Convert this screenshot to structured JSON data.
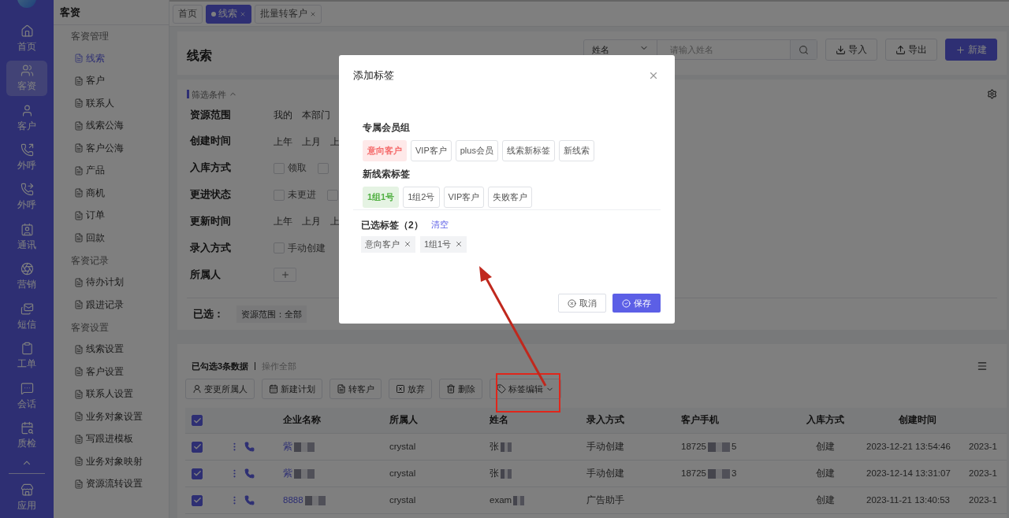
{
  "nav": [
    {
      "label": "首页",
      "selected": false
    },
    {
      "label": "客资",
      "selected": true
    },
    {
      "label": "客户",
      "selected": false
    },
    {
      "label": "外呼",
      "selected": false
    },
    {
      "label": "外呼",
      "selected": false
    },
    {
      "label": "通讯",
      "selected": false
    },
    {
      "label": "营销",
      "selected": false
    },
    {
      "label": "短信",
      "selected": false
    },
    {
      "label": "工单",
      "selected": false
    },
    {
      "label": "会话",
      "selected": false
    },
    {
      "label": "质检",
      "selected": false
    },
    {
      "label": "应用",
      "selected": false
    }
  ],
  "sidebar": {
    "title": "客资",
    "groups": [
      {
        "heading": "客资管理",
        "items": [
          {
            "label": "线索",
            "selected": true
          },
          {
            "label": "客户",
            "selected": false
          },
          {
            "label": "联系人",
            "selected": false
          },
          {
            "label": "线索公海",
            "selected": false
          },
          {
            "label": "客户公海",
            "selected": false
          },
          {
            "label": "产品",
            "selected": false
          },
          {
            "label": "商机",
            "selected": false
          },
          {
            "label": "订单",
            "selected": false
          },
          {
            "label": "回款",
            "selected": false
          }
        ]
      },
      {
        "heading": "客资记录",
        "items": [
          {
            "label": "待办计划",
            "selected": false
          },
          {
            "label": "跟进记录",
            "selected": false
          }
        ]
      },
      {
        "heading": "客资设置",
        "items": [
          {
            "label": "线索设置",
            "selected": false
          },
          {
            "label": "客户设置",
            "selected": false
          },
          {
            "label": "联系人设置",
            "selected": false
          },
          {
            "label": "业务对象设置",
            "selected": false
          },
          {
            "label": "写跟进模板",
            "selected": false
          },
          {
            "label": "业务对象映射",
            "selected": false
          },
          {
            "label": "资源流转设置",
            "selected": false
          }
        ]
      }
    ]
  },
  "tabs": [
    {
      "label": "首页",
      "selected": false,
      "closable": false
    },
    {
      "label": "线索",
      "selected": true,
      "closable": true
    },
    {
      "label": "批量转客户",
      "selected": false,
      "closable": true
    }
  ],
  "header": {
    "title": "线索",
    "search_field": "姓名",
    "search_placeholder": "请输入姓名",
    "buttons": [
      {
        "label": "导入",
        "kind": "import"
      },
      {
        "label": "导出",
        "kind": "export"
      },
      {
        "label": "新建",
        "kind": "primary"
      }
    ]
  },
  "filters": {
    "title": "筛选条件",
    "rows": [
      {
        "label": "资源范围",
        "kind": "options",
        "options": [
          "我的",
          "本部门"
        ]
      },
      {
        "label": "创建时间",
        "kind": "options",
        "options": [
          "上年",
          "上月",
          "上"
        ]
      },
      {
        "label": "入库方式",
        "kind": "checkboxes",
        "options": [
          {
            "label": "领取",
            "checked": false
          },
          {
            "checked": false
          }
        ]
      },
      {
        "label": "更进状态",
        "kind": "checkboxes",
        "options": [
          {
            "label": "未更进",
            "checked": false
          },
          {
            "checked": false
          }
        ]
      },
      {
        "label": "更新时间",
        "kind": "options",
        "options": [
          "上年",
          "上月",
          "上"
        ]
      },
      {
        "label": "录入方式",
        "kind": "checkboxes",
        "options": [
          {
            "label": "手动创建",
            "checked": false
          }
        ]
      },
      {
        "label": "所属人",
        "kind": "add"
      }
    ],
    "summary_label": "已选：",
    "summary_chips": [
      "资源范围：全部"
    ]
  },
  "table": {
    "selection_text": "已勾选3条数据",
    "select_all": "操作全部",
    "actions": [
      {
        "label": "变更所属人"
      },
      {
        "label": "新建计划"
      },
      {
        "label": "转客户"
      },
      {
        "label": "放弃"
      },
      {
        "label": "删除"
      },
      {
        "label": "标签编辑",
        "kind": "dropdown"
      }
    ],
    "header_checked": true,
    "columns": [
      "企业名称",
      "所属人",
      "姓名",
      "录入方式",
      "客户手机",
      "入库方式",
      "创建时间"
    ],
    "rows": [
      {
        "checked": true,
        "company": "紫",
        "owner": "crystal",
        "name": "张",
        "entry": "手动创建",
        "phone_start": "18725",
        "phone_end": "5",
        "storage": "创建",
        "created": "2023-12-21 13:54:46",
        "column_9": "2023-1"
      },
      {
        "checked": true,
        "company": "紫",
        "owner": "crystal",
        "name": "张",
        "entry": "手动创建",
        "phone_start": "18725",
        "phone_end": "3",
        "storage": "创建",
        "created": "2023-12-14 13:31:07",
        "column_9": "2023-1"
      },
      {
        "checked": true,
        "company": "8888",
        "owner": "crystal",
        "name": "exam",
        "entry": "广告助手",
        "storage": "创建",
        "created": "2023-11-21 13:40:53",
        "column_9": "2023-1"
      }
    ]
  },
  "modal": {
    "title": "添加标签",
    "groups": [
      {
        "heading": "专属会员组",
        "tags": [
          {
            "label": "意向客户",
            "selected": true,
            "color": "#f56c6c"
          },
          {
            "label": "VIP客户",
            "selected": false
          },
          {
            "label": "plus会员",
            "selected": false
          },
          {
            "label": "线索新标签",
            "selected": false
          },
          {
            "label": "新线索",
            "selected": false
          }
        ]
      },
      {
        "heading": "新线索标签",
        "tags": [
          {
            "label": "1组1号",
            "selected": true,
            "color": "#52b043"
          },
          {
            "label": "1组2号",
            "selected": false
          },
          {
            "label": "VIP客户",
            "selected": false
          },
          {
            "label": "失败客户",
            "selected": false
          }
        ]
      }
    ],
    "selected_label": "已选标签（2）",
    "clear": "清空",
    "chips": [
      "意向客户",
      "1组1号"
    ],
    "cancel": "取消",
    "save": "保存"
  }
}
